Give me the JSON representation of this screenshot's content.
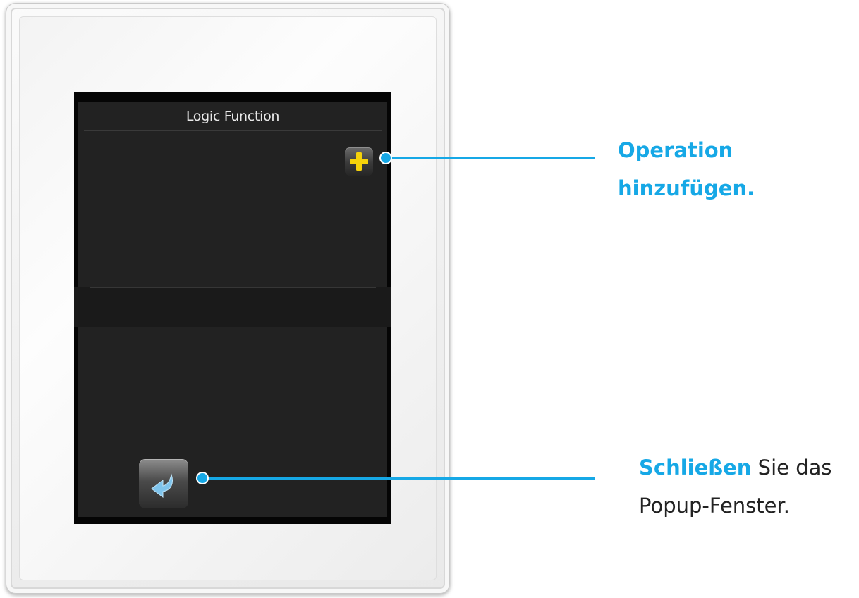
{
  "screen": {
    "title": "Logic Function"
  },
  "buttons": {
    "add_icon": "plus-icon",
    "back_icon": "return-arrow-icon"
  },
  "callouts": {
    "add_operation": {
      "line1": "Operation",
      "line2": "hinzufügen."
    },
    "close_popup": {
      "highlight": "Schließen",
      "rest": " Sie das",
      "line2": "Popup-Fenster."
    }
  },
  "colors": {
    "accent": "#16a8e6",
    "screen_bg": "#222222",
    "plus_icon": "#f5d20a",
    "arrow_icon": "#7fc4ec"
  }
}
